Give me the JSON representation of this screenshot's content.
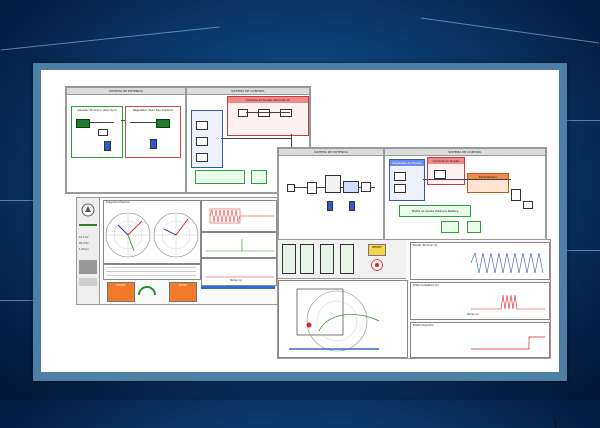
{
  "background": {
    "accent": "#0c3f73"
  },
  "diagram_top_left": {
    "panel_left_title": "SISTEMA DE POTENCIA",
    "panel_right_title": "SISTEMA DE CONTROL",
    "sub_green_label": "Gerador Síncrono (Gen Syn)",
    "sub_red_label": "Regulador (Gen Syn Control)",
    "red_title": "Controle de Tensão Terminal (V)",
    "left_block": "G1",
    "right_block": "G2"
  },
  "diagram_top_right": {
    "panel_left_title": "SISTEMA DE POTENCIA",
    "panel_right_title": "SISTEMA DE CONTROL",
    "blue_title": "Regulador de Tensão",
    "red_title": "Controle de Tensão",
    "orange_title": "Estabilizador",
    "green_title": "Malha de Ajuste Potência Reativa"
  },
  "dashboard_left": {
    "status_values": [
      "10.5 kV",
      "60.0 Hz",
      "1.00 pu"
    ],
    "buttons": [
      "START",
      "STOP"
    ],
    "phasor_title": "Diagrama Fasorial",
    "time_axis": "Tempo (s)"
  },
  "dashboard_right": {
    "button_yellow": "RESET",
    "plot_titles": [
      "Tensão Terminal (V)",
      "Potência Reativa (Q)",
      "Estado Disjuntor"
    ],
    "time_axis": "Tempo (s)"
  },
  "icons": [
    "shield-icon",
    "circle-scope-icon"
  ]
}
